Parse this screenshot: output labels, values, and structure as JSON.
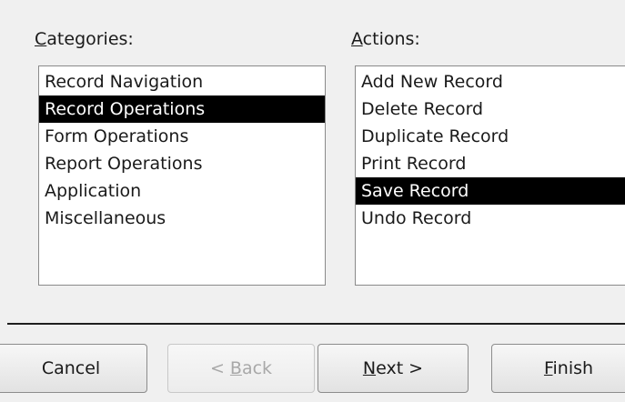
{
  "categories": {
    "label_prefix": "C",
    "label_rest": "ategories:",
    "selected_index": 1,
    "items": [
      "Record Navigation",
      "Record Operations",
      "Form Operations",
      "Report Operations",
      "Application",
      "Miscellaneous"
    ]
  },
  "actions": {
    "label_prefix": "A",
    "label_rest": "ctions:",
    "selected_index": 4,
    "items": [
      "Add New Record",
      "Delete Record",
      "Duplicate Record",
      "Print Record",
      "Save Record",
      "Undo Record"
    ]
  },
  "buttons": {
    "cancel": "Cancel",
    "back_pre": "< ",
    "back_mn": "B",
    "back_rest": "ack",
    "back_enabled": false,
    "next_mn": "N",
    "next_rest": "ext >",
    "finish_mn": "F",
    "finish_rest": "inish"
  },
  "colors": {
    "selection_bg": "#000000",
    "selection_fg": "#ffffff",
    "window_bg": "#f0f0f0"
  }
}
